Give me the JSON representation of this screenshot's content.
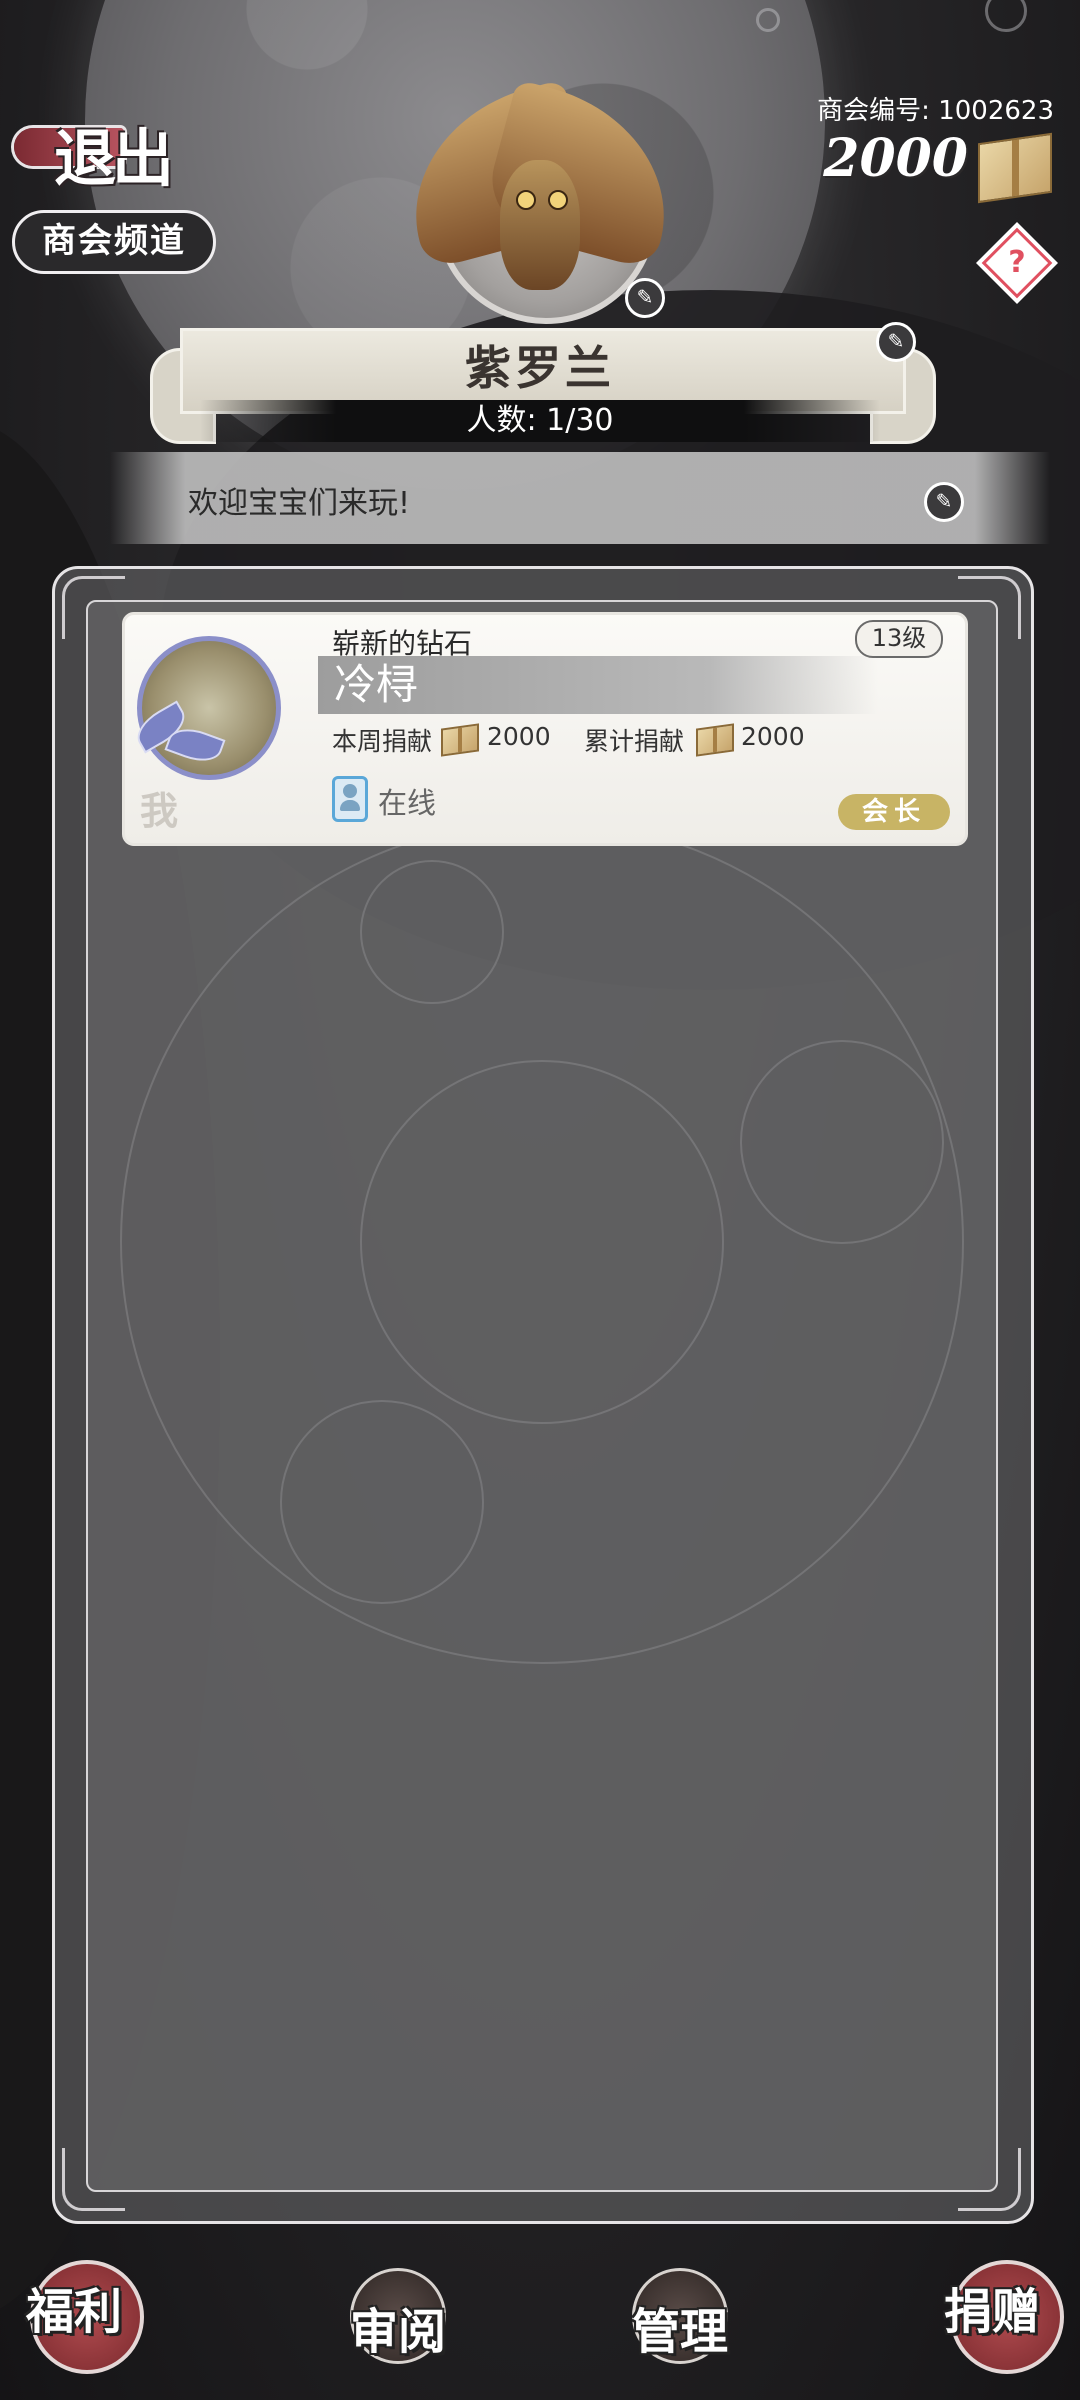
{
  "header": {
    "exit_label": "退出",
    "channel_label": "商会频道",
    "guild_id_text": "商会编号: 1002623",
    "currency_amount": "2000",
    "help_symbol": "?"
  },
  "guild": {
    "name": "紫罗兰",
    "member_count": "人数: 1/30",
    "notice": "欢迎宝宝们来玩!"
  },
  "members": [
    {
      "title": "崭新的钻石",
      "level": "13级",
      "name": "冷桪",
      "weekly_label": "本周捐献",
      "weekly_value": "2000",
      "total_label": "累计捐献",
      "total_value": "2000",
      "self_marker": "我",
      "status": "在线",
      "role": "会长"
    }
  ],
  "nav": {
    "welfare": "福利",
    "review": "审阅",
    "manage": "管理",
    "donate": "捐赠"
  }
}
